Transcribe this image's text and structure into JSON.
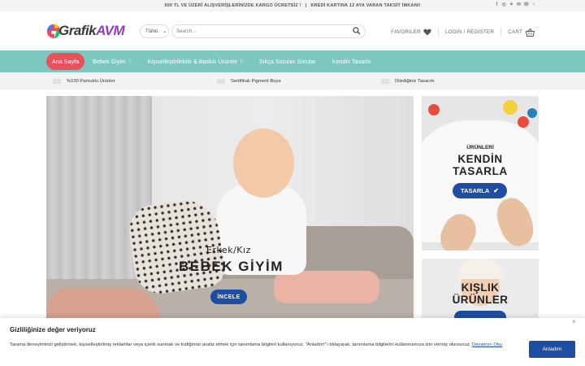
{
  "topbar": {
    "left_text": "500 TL VE ÜZERİ ALIŞVERİŞLERİNİZDE KARGO ÜCRETSİZ !",
    "separator": "|",
    "right_text": "KREDİ KARTINA 12 AYA VARAN TAKSİT İMKANI!",
    "social_icons": [
      "facebook-icon",
      "instagram-icon",
      "twitter-icon",
      "mail-icon",
      "phone-icon",
      "whatsapp-icon"
    ]
  },
  "header": {
    "logo_part1": "Grafik",
    "logo_part2": "AVM",
    "search_category": "Tümü",
    "search_placeholder": "Search...",
    "favorites_label": "FAVORILER",
    "login_label": "LOGIN / REGISTER",
    "cart_label": "CART"
  },
  "nav": {
    "items": [
      {
        "label": "Ana Sayfa",
        "active": true
      },
      {
        "label": "Bebek Giyim",
        "dropdown": true
      },
      {
        "label": "Kişiselleştirilebilir & Baskılı Ürünler",
        "dropdown": true
      },
      {
        "label": "Sıkça Sorulan Sorular"
      },
      {
        "label": "Kendin Tasarla"
      }
    ]
  },
  "features": [
    "%100 Pamuklu Ürünler",
    "Sertifikalı Pigment Boya",
    "Dilediğiniz Tasarım"
  ],
  "hero": {
    "subtitle": "Erkek/Kız",
    "title": "BEBEK GİYİM",
    "button": "İNCELE"
  },
  "banner1": {
    "small": "ÜRÜNLERİ",
    "line1": "KENDİN",
    "line2": "TASARLA",
    "button": "TASARLA"
  },
  "banner2": {
    "line1": "KIŞLIK",
    "line2": "ÜRÜNLER"
  },
  "cookie": {
    "title": "Gizliliğinize değer veriyoruz",
    "text": "Tarama deneyiminizi geliştirmek, kişiselleştirilmiş reklamlar veya içerik sunmak ve trafiğimizi analiz etmek için tanımlama bilgileri kullanıyoruz. \"Anladım\"'ı tıklayarak, tanımlama bilgilerini kullanmamıza izin vermiş olursunuz.",
    "link": "Devamını Oku",
    "button": "Anladım",
    "close": "×"
  },
  "colors": {
    "nav_bg": "#7ec6c0",
    "active": "#e8505b",
    "button": "#1e4ea1",
    "logo_accent": "#8b3fbf"
  }
}
